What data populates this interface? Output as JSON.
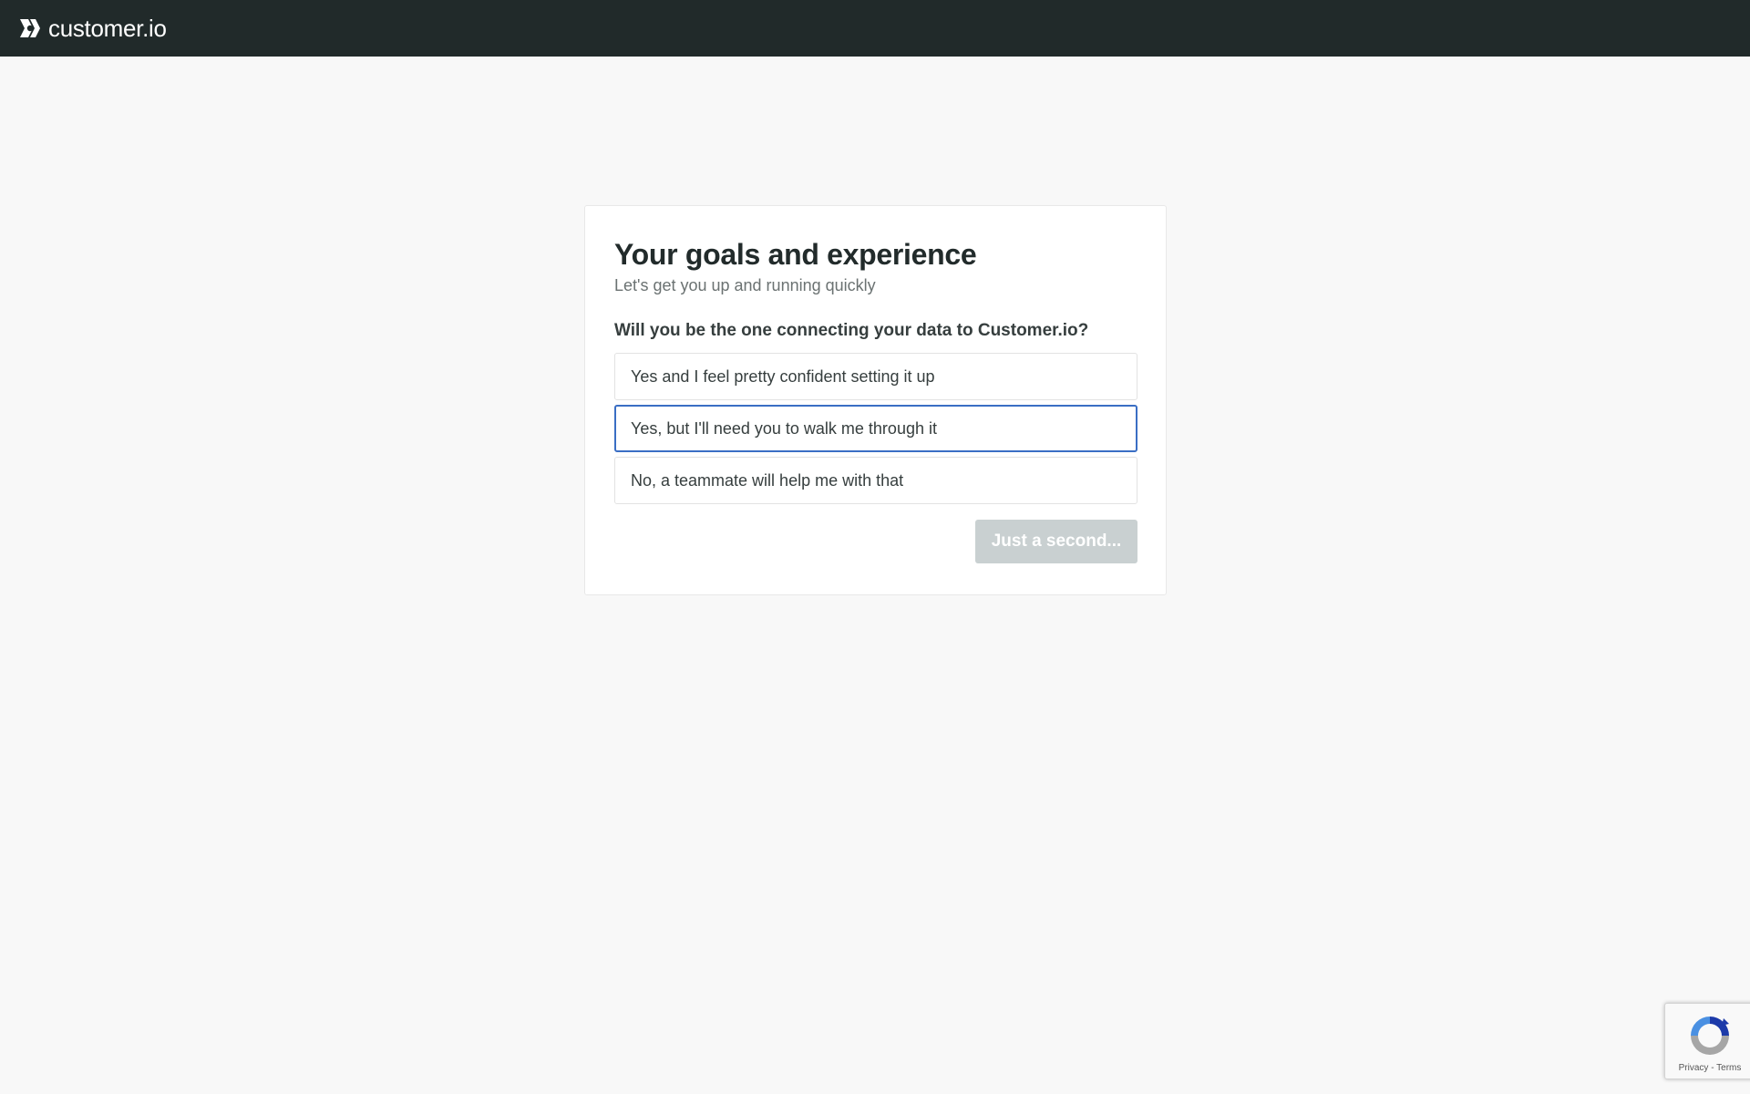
{
  "header": {
    "brand_name": "customer.io",
    "brand_icon": "customerio-logo-icon",
    "background_color": "#212a2a"
  },
  "card": {
    "title": "Your goals and experience",
    "subtitle": "Let's get you up and running quickly",
    "question": "Will you be the one connecting your data to Customer.io?",
    "options": [
      {
        "label": "Yes and I feel pretty confident setting it up",
        "selected": false
      },
      {
        "label": "Yes, but I'll need you to walk me through it",
        "selected": true
      },
      {
        "label": "No, a teammate will help me with that",
        "selected": false
      }
    ],
    "submit_label": "Just a second...",
    "selected_border_color": "#3a6ec4",
    "button_disabled_color": "#c9d0d1"
  },
  "recaptcha": {
    "icon": "recaptcha-icon",
    "privacy_label": "Privacy",
    "separator": " - ",
    "terms_label": "Terms"
  }
}
